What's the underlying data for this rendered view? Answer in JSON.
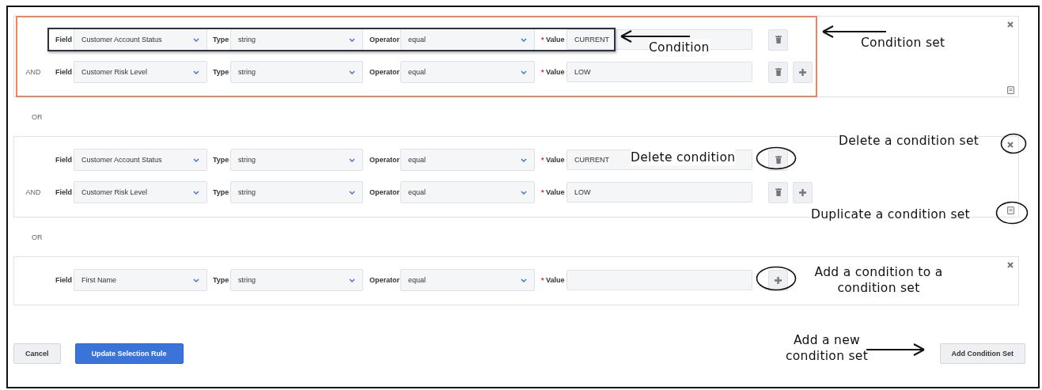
{
  "condition_sets": [
    {
      "highlighted": true,
      "removable": true,
      "duplicable": true,
      "conditions": [
        {
          "highlighted": true,
          "field_label": "Field",
          "field": "Customer Account Status",
          "type_label": "Type",
          "type": "string",
          "operator_label": "Operator",
          "operator": "equal",
          "required_mark": "*",
          "value_label": "Value",
          "value": "CURRENT",
          "actions": [
            {
              "kind": "delete"
            }
          ]
        },
        {
          "highlighted": false,
          "joiner": "AND",
          "field_label": "Field",
          "field": "Customer Risk Level",
          "type_label": "Type",
          "type": "string",
          "operator_label": "Operator",
          "operator": "equal",
          "required_mark": "*",
          "value_label": "Value",
          "value": "LOW",
          "actions": [
            {
              "kind": "delete"
            },
            {
              "kind": "add"
            }
          ]
        }
      ],
      "or_label": "OR"
    },
    {
      "highlighted": false,
      "removable": true,
      "duplicable": true,
      "conditions": [
        {
          "highlighted": false,
          "field_label": "Field",
          "field": "Customer Account Status",
          "type_label": "Type",
          "type": "string",
          "operator_label": "Operator",
          "operator": "equal",
          "required_mark": "*",
          "value_label": "Value",
          "value": "CURRENT",
          "actions": [
            {
              "kind": "delete"
            }
          ]
        },
        {
          "highlighted": false,
          "joiner": "AND",
          "field_label": "Field",
          "field": "Customer Risk Level",
          "type_label": "Type",
          "type": "string",
          "operator_label": "Operator",
          "operator": "equal",
          "required_mark": "*",
          "value_label": "Value",
          "value": "LOW",
          "actions": [
            {
              "kind": "delete"
            },
            {
              "kind": "add"
            }
          ]
        }
      ],
      "or_label": "OR"
    },
    {
      "highlighted": false,
      "removable": true,
      "duplicable": false,
      "conditions": [
        {
          "highlighted": false,
          "field_label": "Field",
          "field": "First Name",
          "type_label": "Type",
          "type": "string",
          "operator_label": "Operator",
          "operator": "equal",
          "required_mark": "*",
          "value_label": "Value",
          "actions": [
            {
              "kind": "add"
            }
          ]
        }
      ]
    }
  ],
  "footer": {
    "buttons": [
      {
        "label": "Cancel",
        "kind": "secondary"
      },
      {
        "label": "Update Selection Rule",
        "kind": "primary"
      },
      {
        "label": "Add Condition Set",
        "kind": "secondary"
      }
    ]
  },
  "annotations": [
    {
      "text": "Condition",
      "kind": "arrow"
    },
    {
      "text": "Condition set",
      "kind": "arrow"
    },
    {
      "text": "Delete condition",
      "kind": "circle"
    },
    {
      "text": "Delete a condition set",
      "kind": "circle"
    },
    {
      "text": "Duplicate a condition set",
      "kind": "circle"
    },
    {
      "text": "Add a condition to a condition set",
      "kind": "circle"
    },
    {
      "text": "Add a new condition set",
      "kind": "arrow"
    }
  ]
}
